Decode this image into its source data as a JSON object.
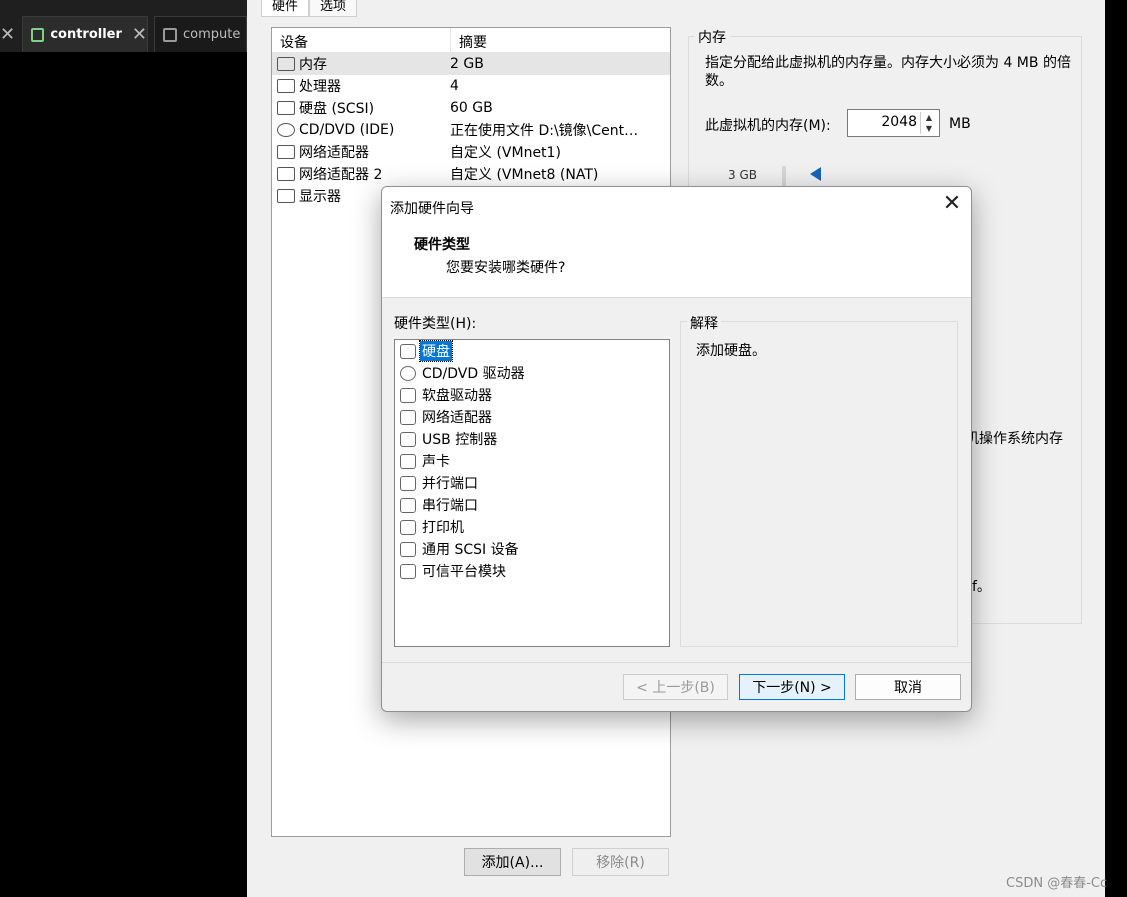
{
  "tabs": {
    "edge_close": "✕",
    "items": [
      {
        "label": "controller",
        "close": "✕"
      },
      {
        "label": "compute"
      }
    ]
  },
  "settings": {
    "tab_hardware": "硬件",
    "tab_options": "选项",
    "col_device": "设备",
    "col_summary": "摘要",
    "devices": [
      {
        "name": "内存",
        "summary": "2 GB",
        "icon": "memory-icon"
      },
      {
        "name": "处理器",
        "summary": "4",
        "icon": "cpu-icon"
      },
      {
        "name": "硬盘 (SCSI)",
        "summary": "60 GB",
        "icon": "hard-disk-icon"
      },
      {
        "name": "CD/DVD (IDE)",
        "summary": "正在使用文件 D:\\镜像\\Cent…",
        "icon": "cd-dvd-icon"
      },
      {
        "name": "网络适配器",
        "summary": "自定义 (VMnet1)",
        "icon": "network-adapter-icon"
      },
      {
        "name": "网络适配器 2",
        "summary": "自定义 (VMnet8 (NAT)",
        "icon": "network-adapter-icon"
      },
      {
        "name": "显示器",
        "summary": "",
        "icon": "display-icon"
      }
    ],
    "add_button": "添加(A)...",
    "remove_button": "移除(R)",
    "memory": {
      "group_title": "内存",
      "description": "指定分配给此虚拟机的内存量。内存大小必须为 4 MB 的倍数。",
      "label": "此虚拟机的内存(M):",
      "value": "2048",
      "unit": "MB",
      "scale_label": "3 GB",
      "peek_text_1": "机操作系统内存",
      "peek_text_2": "f。"
    }
  },
  "dialog": {
    "title": "添加硬件向导",
    "close": "✕",
    "heading": "硬件类型",
    "subheading": "您要安装哪类硬件?",
    "list_label": "硬件类型(H):",
    "hardware_types": [
      {
        "label": "硬盘",
        "icon": "hard-disk-icon",
        "selected": true
      },
      {
        "label": "CD/DVD 驱动器",
        "icon": "cd-dvd-icon"
      },
      {
        "label": "软盘驱动器",
        "icon": "floppy-icon"
      },
      {
        "label": "网络适配器",
        "icon": "network-adapter-icon"
      },
      {
        "label": "USB 控制器",
        "icon": "usb-icon"
      },
      {
        "label": "声卡",
        "icon": "speaker-icon"
      },
      {
        "label": "并行端口",
        "icon": "parallel-port-icon"
      },
      {
        "label": "串行端口",
        "icon": "serial-port-icon"
      },
      {
        "label": "打印机",
        "icon": "printer-icon"
      },
      {
        "label": "通用 SCSI 设备",
        "icon": "scsi-icon"
      },
      {
        "label": "可信平台模块",
        "icon": "tpm-icon"
      }
    ],
    "explanation_title": "解释",
    "explanation_text": "添加硬盘。",
    "back_button": "< 上一步(B)",
    "next_button": "下一步(N) >",
    "cancel_button": "取消"
  },
  "watermark": "CSDN @春春-Cc",
  "colors": {
    "accent": "#0078d7",
    "selection": "#0078d7",
    "dark_bg": "#000000"
  }
}
